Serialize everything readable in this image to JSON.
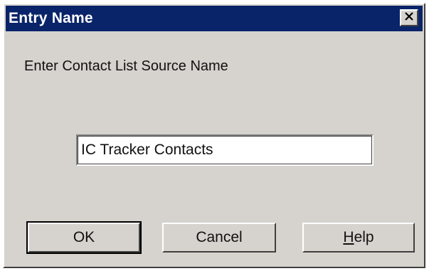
{
  "window": {
    "title": "Entry Name",
    "close_icon": "close-x-icon"
  },
  "prompt": {
    "label": "Enter Contact List Source Name"
  },
  "name_field": {
    "value": "IC Tracker Contacts"
  },
  "buttons": {
    "ok_label": "OK",
    "cancel_label": "Cancel",
    "help_mnemonic": "H",
    "help_rest": "elp"
  },
  "colors": {
    "titlebar": "#0a246a",
    "face": "#d6d3ce"
  }
}
